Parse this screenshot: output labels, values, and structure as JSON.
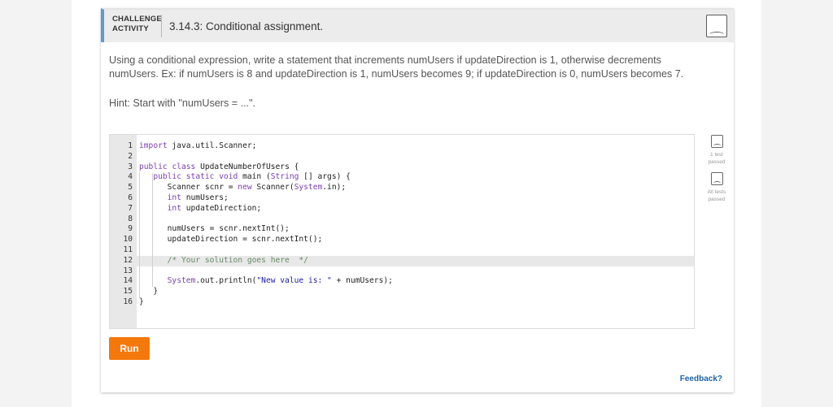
{
  "header": {
    "badge_line1": "CHALLENGE",
    "badge_line2": "ACTIVITY",
    "title": "3.14.3: Conditional assignment.",
    "bookmark_icon": "bookmark-icon"
  },
  "prompt": {
    "description": "Using a conditional expression, write a statement that increments numUsers if updateDirection is 1, otherwise decrements numUsers. Ex: if numUsers is 8 and updateDirection is 1, numUsers becomes 9; if updateDirection is 0, numUsers becomes 7.",
    "hint": "Hint: Start with \"numUsers = ...\"."
  },
  "code": {
    "lines": [
      {
        "n": "1",
        "text": "import java.util.Scanner;"
      },
      {
        "n": "2",
        "text": ""
      },
      {
        "n": "3",
        "text": "public class UpdateNumberOfUsers {"
      },
      {
        "n": "4",
        "text": "   public static void main (String [] args) {"
      },
      {
        "n": "5",
        "text": "      Scanner scnr = new Scanner(System.in);"
      },
      {
        "n": "6",
        "text": "      int numUsers;"
      },
      {
        "n": "7",
        "text": "      int updateDirection;"
      },
      {
        "n": "8",
        "text": ""
      },
      {
        "n": "9",
        "text": "      numUsers = scnr.nextInt();"
      },
      {
        "n": "10",
        "text": "      updateDirection = scnr.nextInt();"
      },
      {
        "n": "11",
        "text": ""
      },
      {
        "n": "12",
        "text": "      /* Your solution goes here  */"
      },
      {
        "n": "13",
        "text": ""
      },
      {
        "n": "14",
        "text": "      System.out.println(\"New value is: \" + numUsers);"
      },
      {
        "n": "15",
        "text": "   }"
      },
      {
        "n": "16",
        "text": "}"
      }
    ],
    "active_line": "12"
  },
  "tests": [
    {
      "label_line1": "1 test",
      "label_line2": "passed"
    },
    {
      "label_line1": "All tests",
      "label_line2": "passed"
    }
  ],
  "actions": {
    "run_label": "Run",
    "feedback_label": "Feedback?"
  }
}
